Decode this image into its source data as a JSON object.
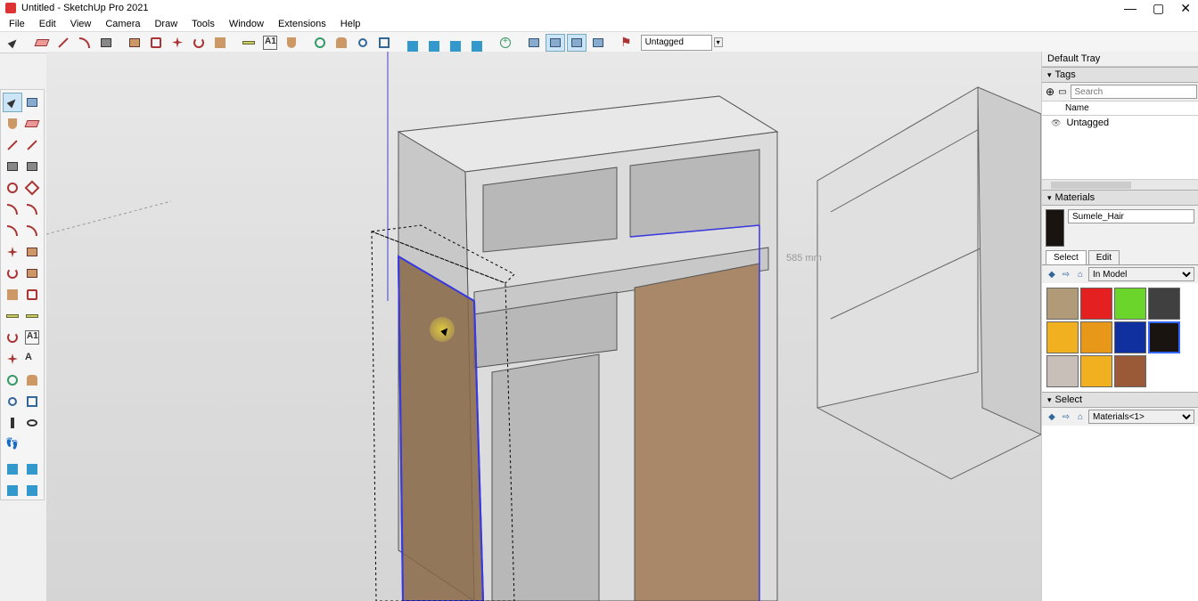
{
  "window": {
    "title": "Untitled - SketchUp Pro 2021",
    "min": "—",
    "max": "▢",
    "close": "✕"
  },
  "menu": [
    "File",
    "Edit",
    "View",
    "Camera",
    "Draw",
    "Tools",
    "Window",
    "Extensions",
    "Help"
  ],
  "toolbar": {
    "tag_value": "Untagged"
  },
  "viewport": {
    "dimension_label": "585 mm"
  },
  "tray": {
    "title": "Default Tray",
    "tags": {
      "title": "Tags",
      "search_placeholder": "Search",
      "name_header": "Name",
      "items": [
        "Untagged"
      ]
    },
    "materials": {
      "title": "Materials",
      "current_name": "Sumele_Hair",
      "tabs": [
        "Select",
        "Edit"
      ],
      "active_tab": 0,
      "library": "In Model",
      "swatches": [
        {
          "color": "#b09a78",
          "name": "tan"
        },
        {
          "color": "#e42020",
          "name": "red"
        },
        {
          "color": "#6cd52c",
          "name": "green"
        },
        {
          "color": "#404040",
          "name": "dark-gray"
        },
        {
          "color": "#f0b020",
          "name": "orange-right"
        },
        {
          "color": "#e89818",
          "name": "orange"
        },
        {
          "color": "#1030a0",
          "name": "navy"
        },
        {
          "color": "#1a1410",
          "name": "dark-brown",
          "selected": true
        },
        {
          "color": "#c8c0b8",
          "name": "light-gray"
        },
        {
          "color": "#f0b020",
          "name": "yellow-right"
        },
        {
          "color": "#9a5a38",
          "name": "brown"
        }
      ]
    },
    "select": {
      "title": "Select",
      "target": "Materials<1>"
    }
  }
}
